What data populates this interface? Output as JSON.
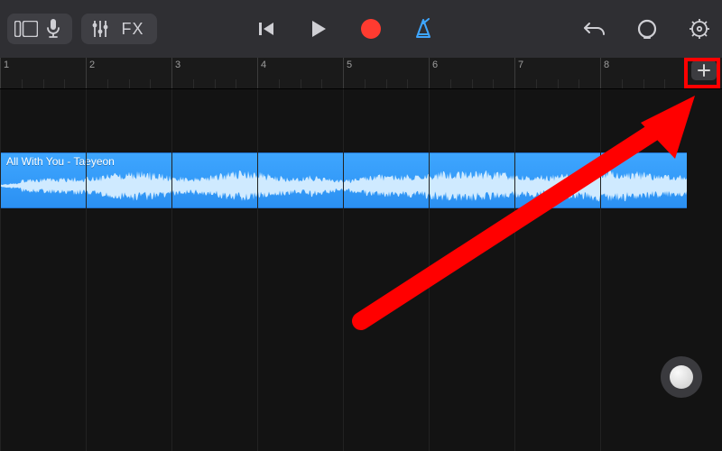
{
  "toolbar": {
    "view_button": "view-toggle",
    "mic_button": "microphone",
    "mixer_button": "mixer",
    "fx_label": "FX",
    "back_button": "go-to-beginning",
    "play_button": "play",
    "record_button": "record",
    "metronome_button": "metronome",
    "undo_button": "undo",
    "loop_button": "loop-browser",
    "settings_button": "settings"
  },
  "ruler": {
    "bars": [
      1,
      2,
      3,
      4,
      5,
      6,
      7,
      8
    ],
    "add_section": "+"
  },
  "track": {
    "region_label": "All With You - Taeyeon",
    "region_color": "#3ea6ff"
  },
  "floating_button": "assistive-touch",
  "annotation": {
    "target": "add-section-button",
    "color": "#ff0000"
  }
}
